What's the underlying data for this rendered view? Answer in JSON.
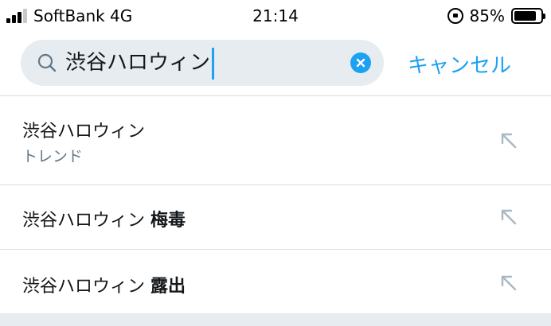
{
  "status_bar": {
    "carrier": "SoftBank 4G",
    "time": "21:14",
    "battery_percent": "85%",
    "battery_level": 0.85
  },
  "search": {
    "query": "渋谷ハロウィン",
    "cancel_label": "キャンセル"
  },
  "suggestions": [
    {
      "query": "渋谷ハロウィン",
      "suffix": "",
      "subtitle": "トレンド"
    },
    {
      "query": "渋谷ハロウィン",
      "suffix": "梅毒",
      "subtitle": ""
    },
    {
      "query": "渋谷ハロウィン",
      "suffix": "露出",
      "subtitle": ""
    }
  ],
  "colors": {
    "accent": "#1da1f2",
    "search_bg": "#e6ecf0",
    "secondary_text": "#657786"
  }
}
